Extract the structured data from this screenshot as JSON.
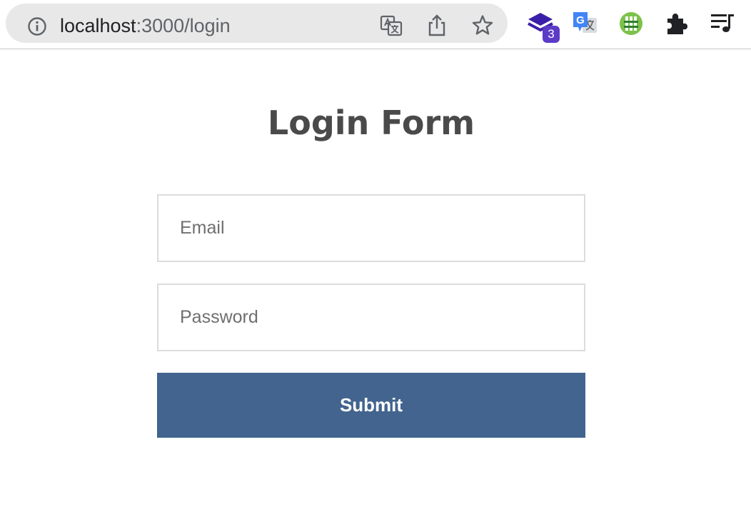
{
  "browser": {
    "url_host": "localhost",
    "url_rest": ":3000/login",
    "extension_badge": "3",
    "icons": [
      "info-icon",
      "translate-icon",
      "share-icon",
      "bookmark-star-icon",
      "stack-extension-icon",
      "google-translate-icon",
      "fence-extension-icon",
      "puzzle-extensions-icon",
      "media-queue-icon"
    ]
  },
  "page": {
    "title": "Login Form"
  },
  "form": {
    "email_placeholder": "Email",
    "password_placeholder": "Password",
    "submit_label": "Submit"
  },
  "colors": {
    "submit_bg": "#42648f",
    "title": "#4a4a4a",
    "badge": "#5c3bc7"
  }
}
